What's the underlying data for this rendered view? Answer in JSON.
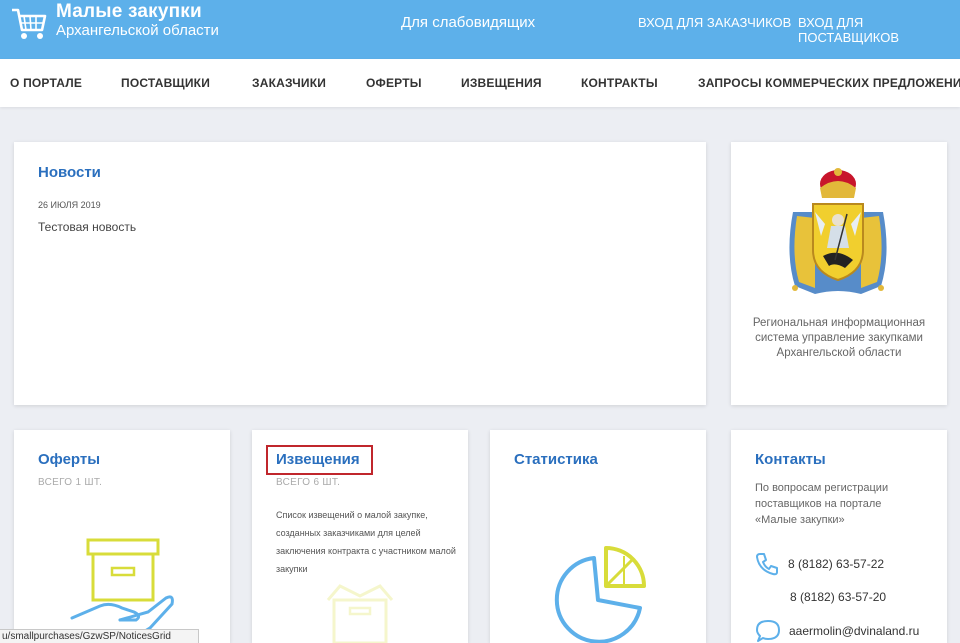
{
  "header": {
    "title": "Малые закупки",
    "subtitle": "Архангельской области",
    "accessibility_link": "Для слабовидящих",
    "customer_login": "ВХОД ДЛЯ ЗАКАЗЧИКОВ",
    "supplier_login": "ВХОД ДЛЯ ПОСТАВЩИКОВ"
  },
  "nav": {
    "items": [
      "О ПОРТАЛЕ",
      "ПОСТАВЩИКИ",
      "ЗАКАЗЧИКИ",
      "ОФЕРТЫ",
      "ИЗВЕЩЕНИЯ",
      "КОНТРАКТЫ",
      "ЗАПРОСЫ КОММЕРЧЕСКИХ ПРЕДЛОЖЕНИЙ"
    ]
  },
  "news": {
    "title": "Новости",
    "date": "26 ИЮЛЯ 2019",
    "item": "Тестовая новость"
  },
  "region": {
    "text": "Региональная информационная система управление закупками Архангельской области"
  },
  "offers": {
    "title": "Оферты",
    "count": "ВСЕГО 1 ШТ."
  },
  "notices": {
    "title": "Извещения",
    "count": "ВСЕГО 6 ШТ.",
    "description": "Список извещений о малой закупке, созданных заказчиками для целей заключения контракта с участником малой закупки"
  },
  "statistics": {
    "title": "Статистика"
  },
  "contacts": {
    "title": "Контакты",
    "description": "По вопросам регистрации поставщиков на портале «Малые закупки»",
    "phone1": "8 (8182) 63-57-22",
    "phone2": "8 (8182) 63-57-20",
    "email": "aaermolin@dvinaland.ru"
  },
  "status_bar": {
    "url": "u/smallpurchases/GzwSP/NoticesGrid"
  },
  "colors": {
    "header_bg": "#5db0ea",
    "title_blue": "#2a6fbe",
    "icon_yellow": "#d8dc3a",
    "icon_blue": "#5db0ea",
    "highlight_red": "#c0262c"
  },
  "icons": {
    "logo": "shopping-cart-icon",
    "offers": "box-in-hand-icon",
    "notices": "open-box-icon",
    "statistics": "pie-chart-icon",
    "phone": "phone-icon",
    "email": "chat-bubble-icon",
    "region": "coat-of-arms-emblem"
  }
}
